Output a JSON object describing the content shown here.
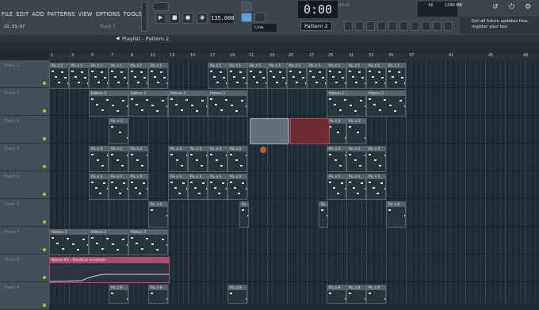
{
  "menu": [
    "FILE",
    "EDIT",
    "ADD",
    "PATTERNS",
    "VIEW",
    "OPTIONS",
    "TOOLS",
    "?"
  ],
  "clock": "22:53:07",
  "hint_track": "Track 3",
  "tempo": "135.000",
  "time_display": "0:00",
  "time_suffix": "00",
  "time_unit": "M:S:CS",
  "pattern_selector": "Pattern 2",
  "snap_mode": "Line",
  "cpu_value": "16",
  "memory": "1290 MB",
  "news": [
    "Get all future updates free,",
    "register your box"
  ],
  "playlist_title": "Playlist - Pattern 2",
  "ruler": [
    "1",
    "3",
    "5",
    "7",
    "9",
    "11",
    "13",
    "15",
    "17",
    "19",
    "21",
    "23",
    "25",
    "27",
    "29",
    "31",
    "33",
    "35",
    "37",
    "41",
    "45",
    "49"
  ],
  "tracks": [
    "Track 1",
    "Track 2",
    "Track 3",
    "Track 4",
    "Track 5",
    "Track 6",
    "Track 7",
    "Track 8",
    "Track 9"
  ],
  "clip_labels": {
    "pattern2": "Pattern 2",
    "pattern3": "Pattern 3",
    "patn1": "Pa..n 1",
    "patn3": "Pa..n 3",
    "patn4": "Pa..n 4",
    "patn5": "Pa..n 5",
    "patn6": "Pa..n 6",
    "patn8": "Pa..n 8",
    "automation": "Nexus #1 - fmodCut envelope"
  },
  "colors": {
    "accent": "#9bd23a",
    "selection_red": "#d24a56",
    "automation": "#a94f73"
  }
}
